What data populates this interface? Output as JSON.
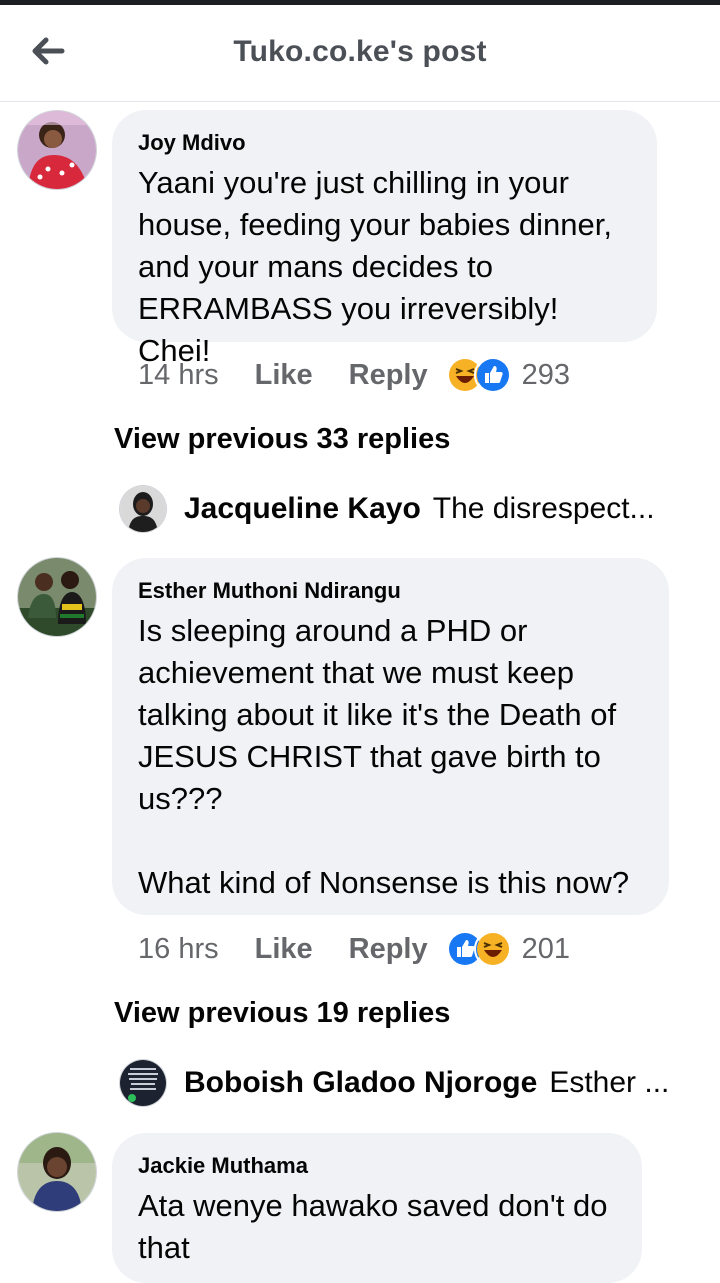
{
  "header": {
    "title": "Tuko.co.ke's post",
    "back_icon": "back-arrow-icon"
  },
  "colors": {
    "like_blue": "#1877f2",
    "haha_yellow": "#f7b125",
    "bubble_bg": "#f0f2f5",
    "meta_gray": "#65676b"
  },
  "comments": [
    {
      "author": "Joy Mdivo",
      "text": "Yaani you're just chilling in your house, feeding your babies dinner, and your mans decides to ERRAMBASS you irreversibly! Chei!",
      "time": "14 hrs",
      "like_label": "Like",
      "reply_label": "Reply",
      "reactions": [
        "haha",
        "like"
      ],
      "reaction_count": "293",
      "view_previous": "View previous 33 replies",
      "latest_reply": {
        "name": "Jacqueline Kayo",
        "text": "The disrespect..."
      }
    },
    {
      "author": "Esther Muthoni Ndirangu",
      "text": "Is sleeping around a PHD or achievement that we must keep talking about it like it's the Death of JESUS CHRIST that gave birth to us???\n\nWhat kind of Nonsense is this now?",
      "time": "16 hrs",
      "like_label": "Like",
      "reply_label": "Reply",
      "reactions": [
        "like",
        "haha"
      ],
      "reaction_count": "201",
      "view_previous": "View previous 19 replies",
      "latest_reply": {
        "name": "Boboish Gladoo Njoroge",
        "text": "Esther ..."
      }
    },
    {
      "author": "Jackie Muthama",
      "text": "Ata wenye hawako saved don't do that"
    }
  ]
}
